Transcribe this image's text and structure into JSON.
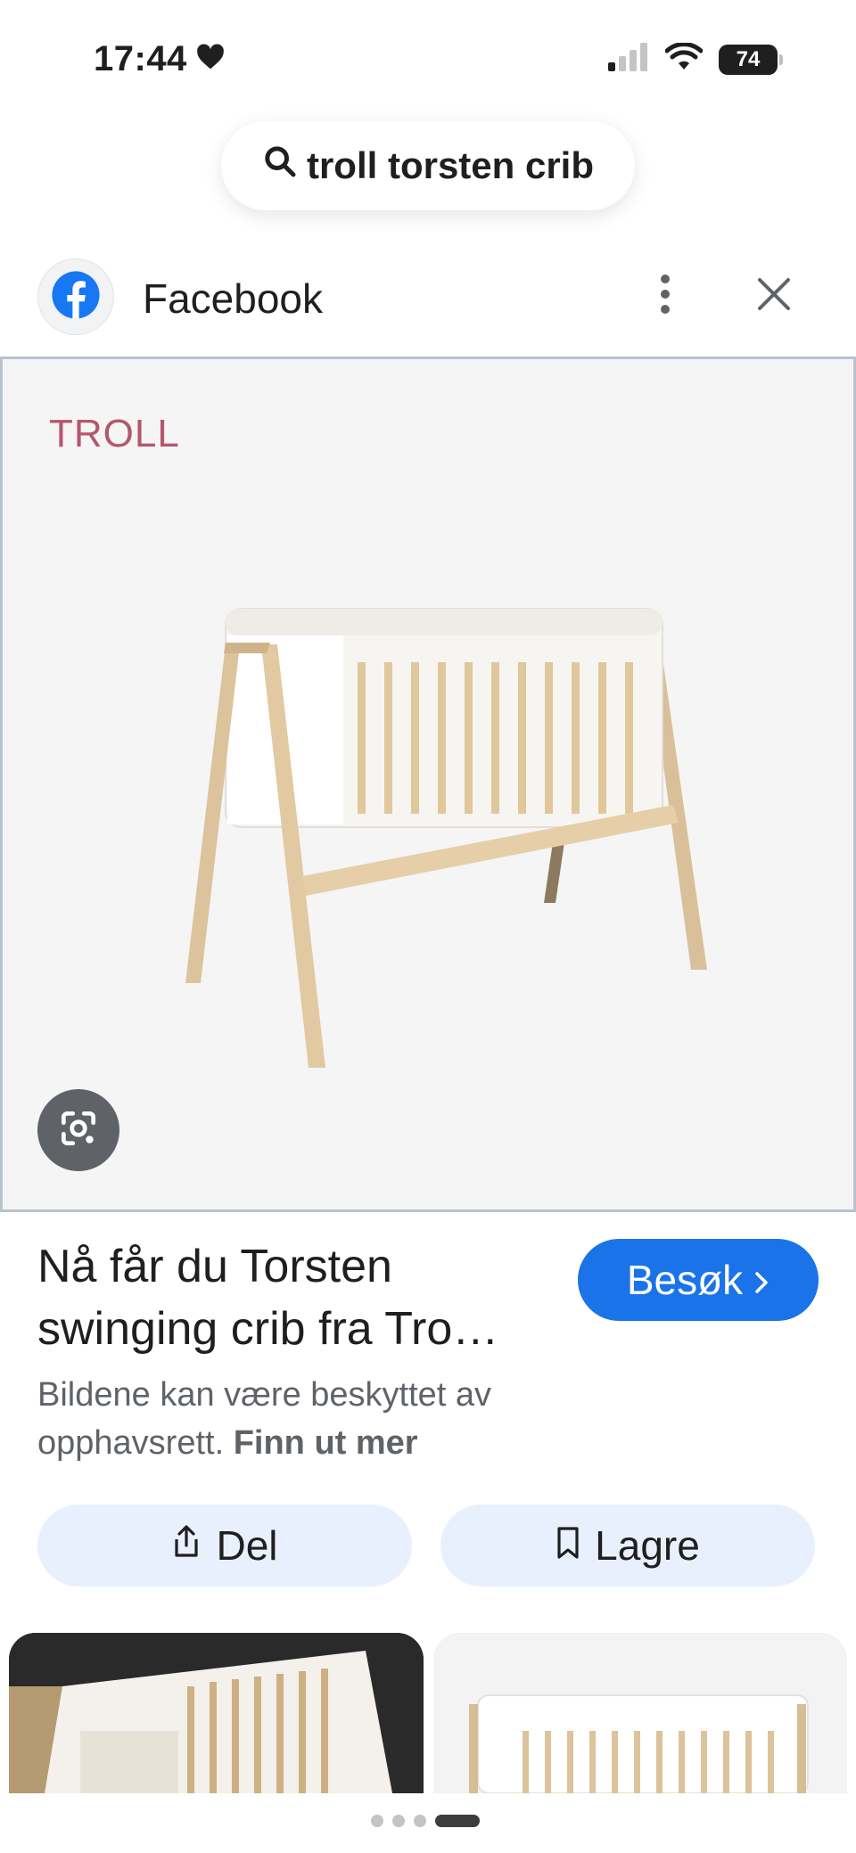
{
  "status_bar": {
    "time": "17:44",
    "battery": "74"
  },
  "search": {
    "query": "troll torsten crib"
  },
  "source": {
    "name": "Facebook"
  },
  "image": {
    "brand_logo": "TROLL"
  },
  "result": {
    "title": "Nå får du Torsten swinging crib fra Tro…",
    "visit_label": "Besøk",
    "copyright_text": "Bildene kan være beskyttet av opphavsrett.",
    "learn_more_label": "Finn ut mer"
  },
  "actions": {
    "share_label": "Del",
    "save_label": "Lagre"
  },
  "colors": {
    "accent": "#1a73e8",
    "chip_bg": "#e8f0fe",
    "facebook_blue": "#1877f2"
  },
  "icons": {
    "heart": "heart-icon",
    "signal": "cellular-signal-icon",
    "wifi": "wifi-icon",
    "search": "search-icon",
    "facebook": "facebook-icon",
    "more": "more-vertical-icon",
    "close": "close-icon",
    "lens": "lens-icon",
    "chevron": "chevron-right-icon",
    "share": "share-icon",
    "bookmark": "bookmark-icon"
  }
}
